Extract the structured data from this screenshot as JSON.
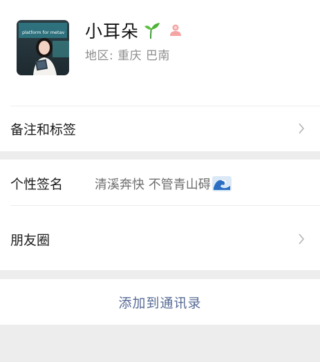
{
  "profile": {
    "name": "小耳朵",
    "region_label": "地区: ",
    "region_value": "重庆 巴南",
    "name_icon": "sprout-icon",
    "gender_icon": "female-icon",
    "avatar_text": "platform for metav"
  },
  "rows": {
    "remark_label": "备注和标签",
    "signature_label": "个性签名",
    "signature_value": "清溪奔快 不管青山碍",
    "signature_icon": "wave-icon",
    "moments_label": "朋友圈"
  },
  "actions": {
    "add_contact_label": "添加到通讯录"
  },
  "colors": {
    "link": "#576b95",
    "background": "#ededed",
    "muted_text": "#8d8d8d"
  }
}
